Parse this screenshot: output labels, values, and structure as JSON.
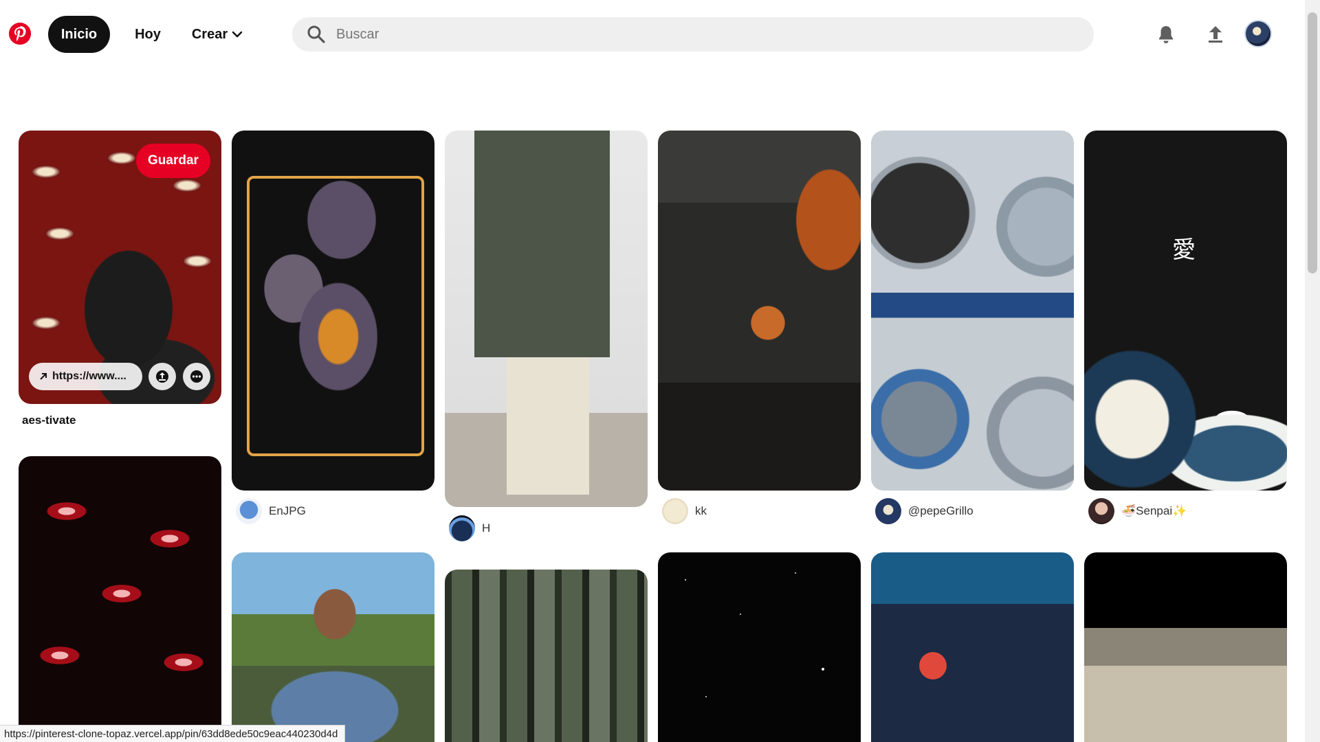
{
  "header": {
    "logo_icon": "pinterest-logo-icon",
    "nav": [
      {
        "label": "Inicio"
      },
      {
        "label": "Hoy"
      },
      {
        "label": "Crear"
      }
    ],
    "search": {
      "placeholder": "Buscar",
      "value": ""
    },
    "icons": [
      "bell-icon",
      "upload-icon",
      "avatar"
    ]
  },
  "colors": {
    "brand": "#e60023",
    "nav_active_bg": "#111111",
    "search_bg": "#efefef"
  },
  "pins": [
    {
      "id": "pin-1",
      "title": "aes-tivate",
      "save_label": "Guardar",
      "link_label": "https://www....",
      "hovered": true
    },
    {
      "id": "pin-2",
      "author": "EnJPG"
    },
    {
      "id": "pin-3",
      "author": "H"
    },
    {
      "id": "pin-4",
      "author": "kk"
    },
    {
      "id": "pin-5",
      "author": "@pepeGrillo"
    },
    {
      "id": "pin-6",
      "author": "🍜Senpai✨"
    },
    {
      "id": "pin-7",
      "author": ""
    },
    {
      "id": "pin-8",
      "author": ""
    },
    {
      "id": "pin-9",
      "author": ""
    },
    {
      "id": "pin-10",
      "author": ""
    },
    {
      "id": "pin-11",
      "author": ""
    },
    {
      "id": "pin-12",
      "author": ""
    }
  ],
  "status_bar": {
    "url": "https://pinterest-clone-topaz.vercel.app/pin/63dd8ede50c9eac440230d4d"
  }
}
